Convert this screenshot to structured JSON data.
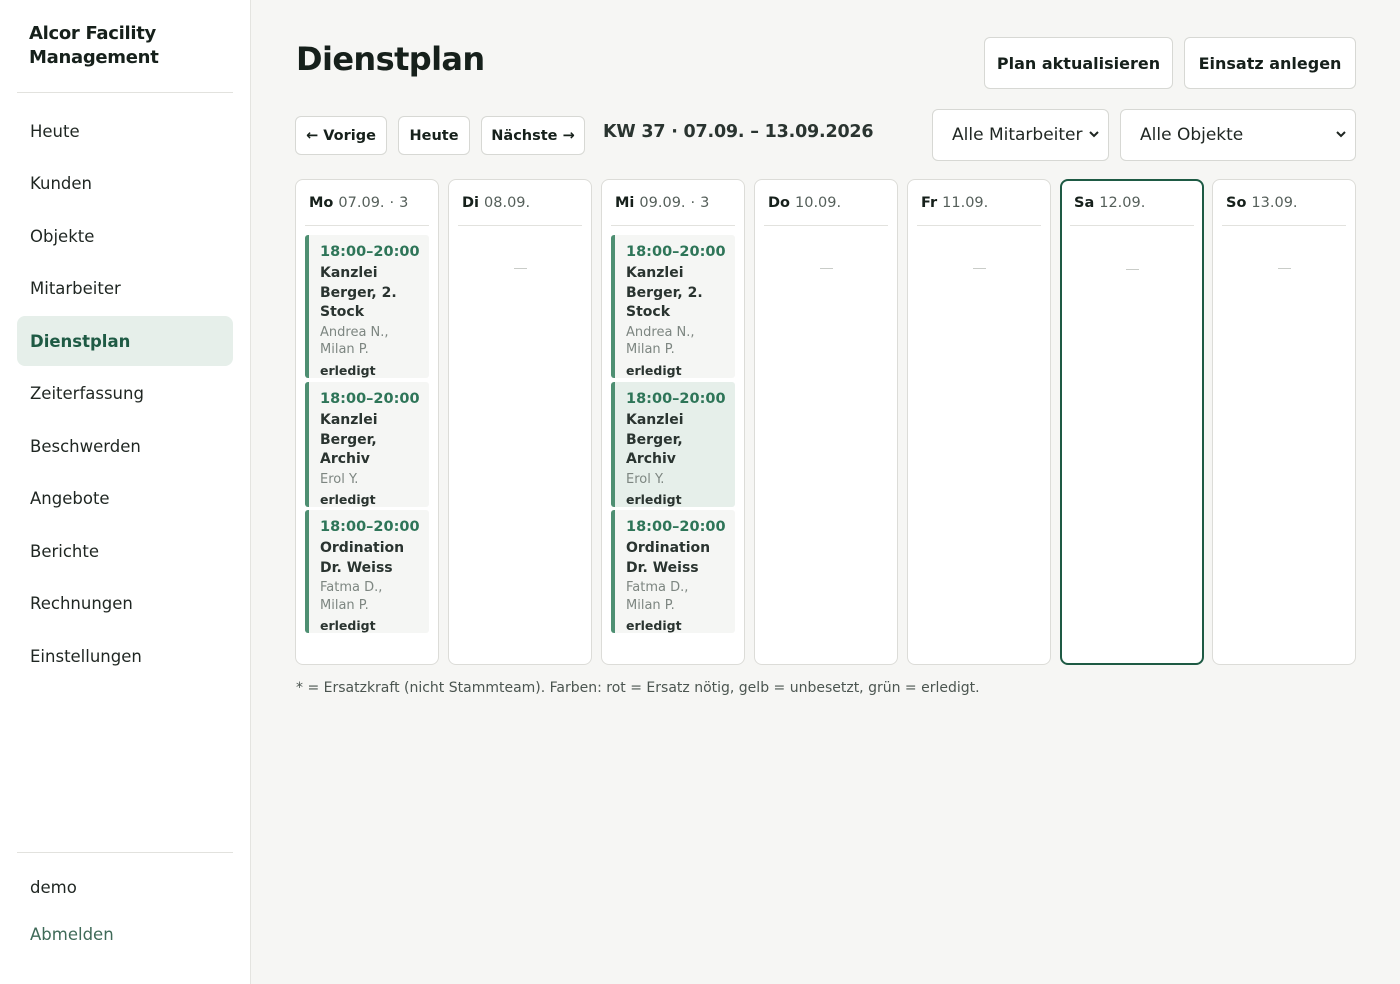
{
  "brand": {
    "line1": "Alcor Facility",
    "line2": "Management"
  },
  "nav": [
    {
      "label": "Heute",
      "active": false
    },
    {
      "label": "Kunden",
      "active": false
    },
    {
      "label": "Objekte",
      "active": false
    },
    {
      "label": "Mitarbeiter",
      "active": false
    },
    {
      "label": "Dienstplan",
      "active": true
    },
    {
      "label": "Zeiterfassung",
      "active": false
    },
    {
      "label": "Beschwerden",
      "active": false
    },
    {
      "label": "Angebote",
      "active": false
    },
    {
      "label": "Berichte",
      "active": false
    },
    {
      "label": "Rechnungen",
      "active": false
    },
    {
      "label": "Einstellungen",
      "active": false
    }
  ],
  "user": {
    "name": "demo",
    "logout": "Abmelden"
  },
  "page": {
    "title": "Dienstplan"
  },
  "actions": {
    "refresh": "Plan aktualisieren",
    "create": "Einsatz anlegen"
  },
  "week_nav": {
    "prev": "← Vorige",
    "today": "Heute",
    "next": "Nächste →",
    "label": "KW 37 · 07.09. – 13.09.2026"
  },
  "filters": {
    "employee": "Alle Mitarbeiter",
    "object": "Alle Objekte"
  },
  "days": [
    {
      "name": "Mo",
      "date": "07.09.",
      "count": "3",
      "today": false,
      "shifts": [
        {
          "time": "18:00–20:00",
          "object": "Kanzlei Berger, 2. Stock",
          "staff": "Andrea N., Milan P.",
          "status": "erledigt",
          "highlight": false
        },
        {
          "time": "18:00–20:00",
          "object": "Kanzlei Berger, Archiv",
          "staff": "Erol Y.",
          "status": "erledigt",
          "highlight": false
        },
        {
          "time": "18:00–20:00",
          "object": "Ordination Dr. Weiss",
          "staff": "Fatma D., Milan P.",
          "status": "erledigt",
          "highlight": false
        }
      ]
    },
    {
      "name": "Di",
      "date": "08.09.",
      "count": "",
      "today": false,
      "shifts": [],
      "empty": "—"
    },
    {
      "name": "Mi",
      "date": "09.09.",
      "count": "3",
      "today": false,
      "shifts": [
        {
          "time": "18:00–20:00",
          "object": "Kanzlei Berger, 2. Stock",
          "staff": "Andrea N., Milan P.",
          "status": "erledigt",
          "highlight": false
        },
        {
          "time": "18:00–20:00",
          "object": "Kanzlei Berger, Archiv",
          "staff": "Erol Y.",
          "status": "erledigt",
          "highlight": true
        },
        {
          "time": "18:00–20:00",
          "object": "Ordination Dr. Weiss",
          "staff": "Fatma D., Milan P.",
          "status": "erledigt",
          "highlight": false
        }
      ]
    },
    {
      "name": "Do",
      "date": "10.09.",
      "count": "",
      "today": false,
      "shifts": [],
      "empty": "—"
    },
    {
      "name": "Fr",
      "date": "11.09.",
      "count": "",
      "today": false,
      "shifts": [],
      "empty": "—"
    },
    {
      "name": "Sa",
      "date": "12.09.",
      "count": "",
      "today": true,
      "shifts": [],
      "empty": "—"
    },
    {
      "name": "So",
      "date": "13.09.",
      "count": "",
      "today": false,
      "shifts": [],
      "empty": "—"
    }
  ],
  "footnote": "* = Ersatzkraft (nicht Stammteam). Farben: rot = Ersatz nötig, gelb = unbesetzt, grün = erledigt.",
  "colors": {
    "accent": "#1e5a44",
    "shift_bar": "#4e8f72",
    "time_text": "#2e7558",
    "active_nav_bg": "#e6efea"
  }
}
